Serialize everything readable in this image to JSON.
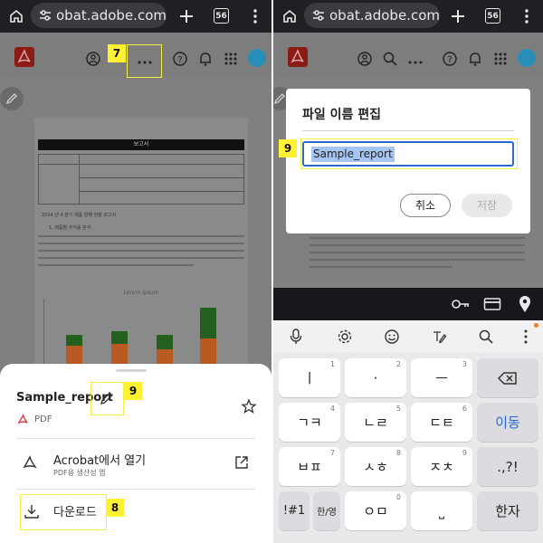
{
  "left": {
    "browser": {
      "url": "obat.adobe.com",
      "tab_count": "56"
    },
    "toolbar": {
      "callout_more": "7"
    },
    "document": {
      "title": "보고서",
      "section_heading": "2024 년 4 분기 제품 판매 현황 보고서",
      "sub_heading": "1.  제품별 수익률 분석",
      "chart_title": "Lorem ipsum"
    },
    "sheet": {
      "file_name": "Sample_report",
      "file_type": "PDF",
      "callout_edit": "9",
      "open_label": "Acrobat에서 열기",
      "open_sub": "PDF용 생산성 앱",
      "download_label": "다운로드",
      "callout_download": "8"
    }
  },
  "right": {
    "browser": {
      "url": "obat.adobe.com",
      "tab_count": "56"
    },
    "dialog": {
      "title": "파일 이름 편집",
      "input_value": "Sample_report",
      "callout": "9",
      "cancel_label": "취소",
      "save_label": "저장"
    },
    "keyboard": {
      "rows": [
        [
          {
            "label": "ㅣ",
            "num": "1"
          },
          {
            "label": "·",
            "num": "2"
          },
          {
            "label": "ㅡ",
            "num": "3"
          },
          {
            "label": "⌫",
            "num": ""
          }
        ],
        [
          {
            "label": "ㄱㅋ",
            "num": "4"
          },
          {
            "label": "ㄴㄹ",
            "num": "5"
          },
          {
            "label": "ㄷㅌ",
            "num": "6"
          },
          {
            "label": "이동",
            "num": ""
          }
        ],
        [
          {
            "label": "ㅂㅍ",
            "num": "7"
          },
          {
            "label": "ㅅㅎ",
            "num": "8"
          },
          {
            "label": "ㅈㅊ",
            "num": "9"
          },
          {
            "label": ".,?!",
            "num": ""
          }
        ],
        [
          {
            "label": "!#1",
            "num": ""
          },
          {
            "label": "한/영",
            "num": ""
          },
          {
            "label": "ㅇㅁ",
            "num": "0"
          },
          {
            "label": "⎵",
            "num": ""
          },
          {
            "label": "한자",
            "num": ""
          }
        ]
      ]
    }
  }
}
